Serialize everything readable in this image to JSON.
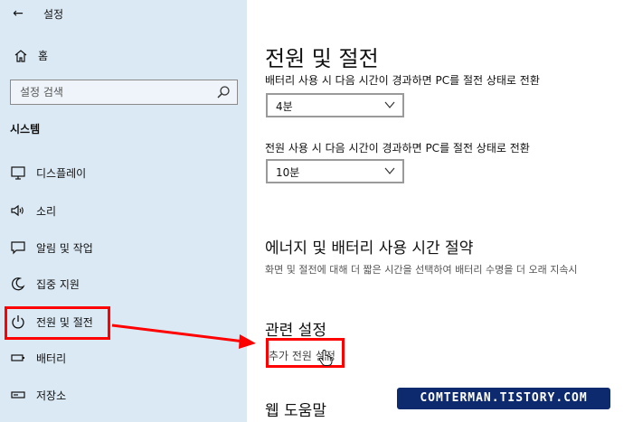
{
  "window": {
    "title": "설정",
    "back_icon": "back-arrow-icon"
  },
  "sidebar": {
    "home_label": "홈",
    "search": {
      "placeholder": "설정 검색"
    },
    "section_label": "시스템",
    "items": [
      {
        "label": "디스플레이",
        "icon": "display-icon"
      },
      {
        "label": "소리",
        "icon": "sound-icon"
      },
      {
        "label": "알림 및 작업",
        "icon": "notification-icon"
      },
      {
        "label": "집중 지원",
        "icon": "focus-assist-icon"
      },
      {
        "label": "전원 및 절전",
        "icon": "power-icon",
        "selected": true
      },
      {
        "label": "배터리",
        "icon": "battery-icon"
      },
      {
        "label": "저장소",
        "icon": "storage-icon"
      }
    ]
  },
  "main": {
    "title": "전원 및 절전",
    "battery_sleep": {
      "label": "배터리 사용 시 다음 시간이 경과하면 PC를 절전 상태로 전환",
      "value": "4분"
    },
    "plugged_sleep": {
      "label": "전원 사용 시 다음 시간이 경과하면 PC를 절전 상태로 전환",
      "value": "10분"
    },
    "energy_heading": "에너지 및 배터리 사용 시간 절약",
    "energy_desc": "화면 및 절전에 대해 더 짧은 시간을 선택하여 배터리 수명을 더 오래 지속시",
    "related_heading": "관련 설정",
    "related_link": "추가 전원 설정",
    "help_heading": "웹 도움말"
  },
  "watermark": "COMTERMAN.TISTORY.COM",
  "colors": {
    "sidebar_bg": "#dbe9f4",
    "highlight": "#ff0000",
    "watermark_bg": "#0e2a6e"
  }
}
